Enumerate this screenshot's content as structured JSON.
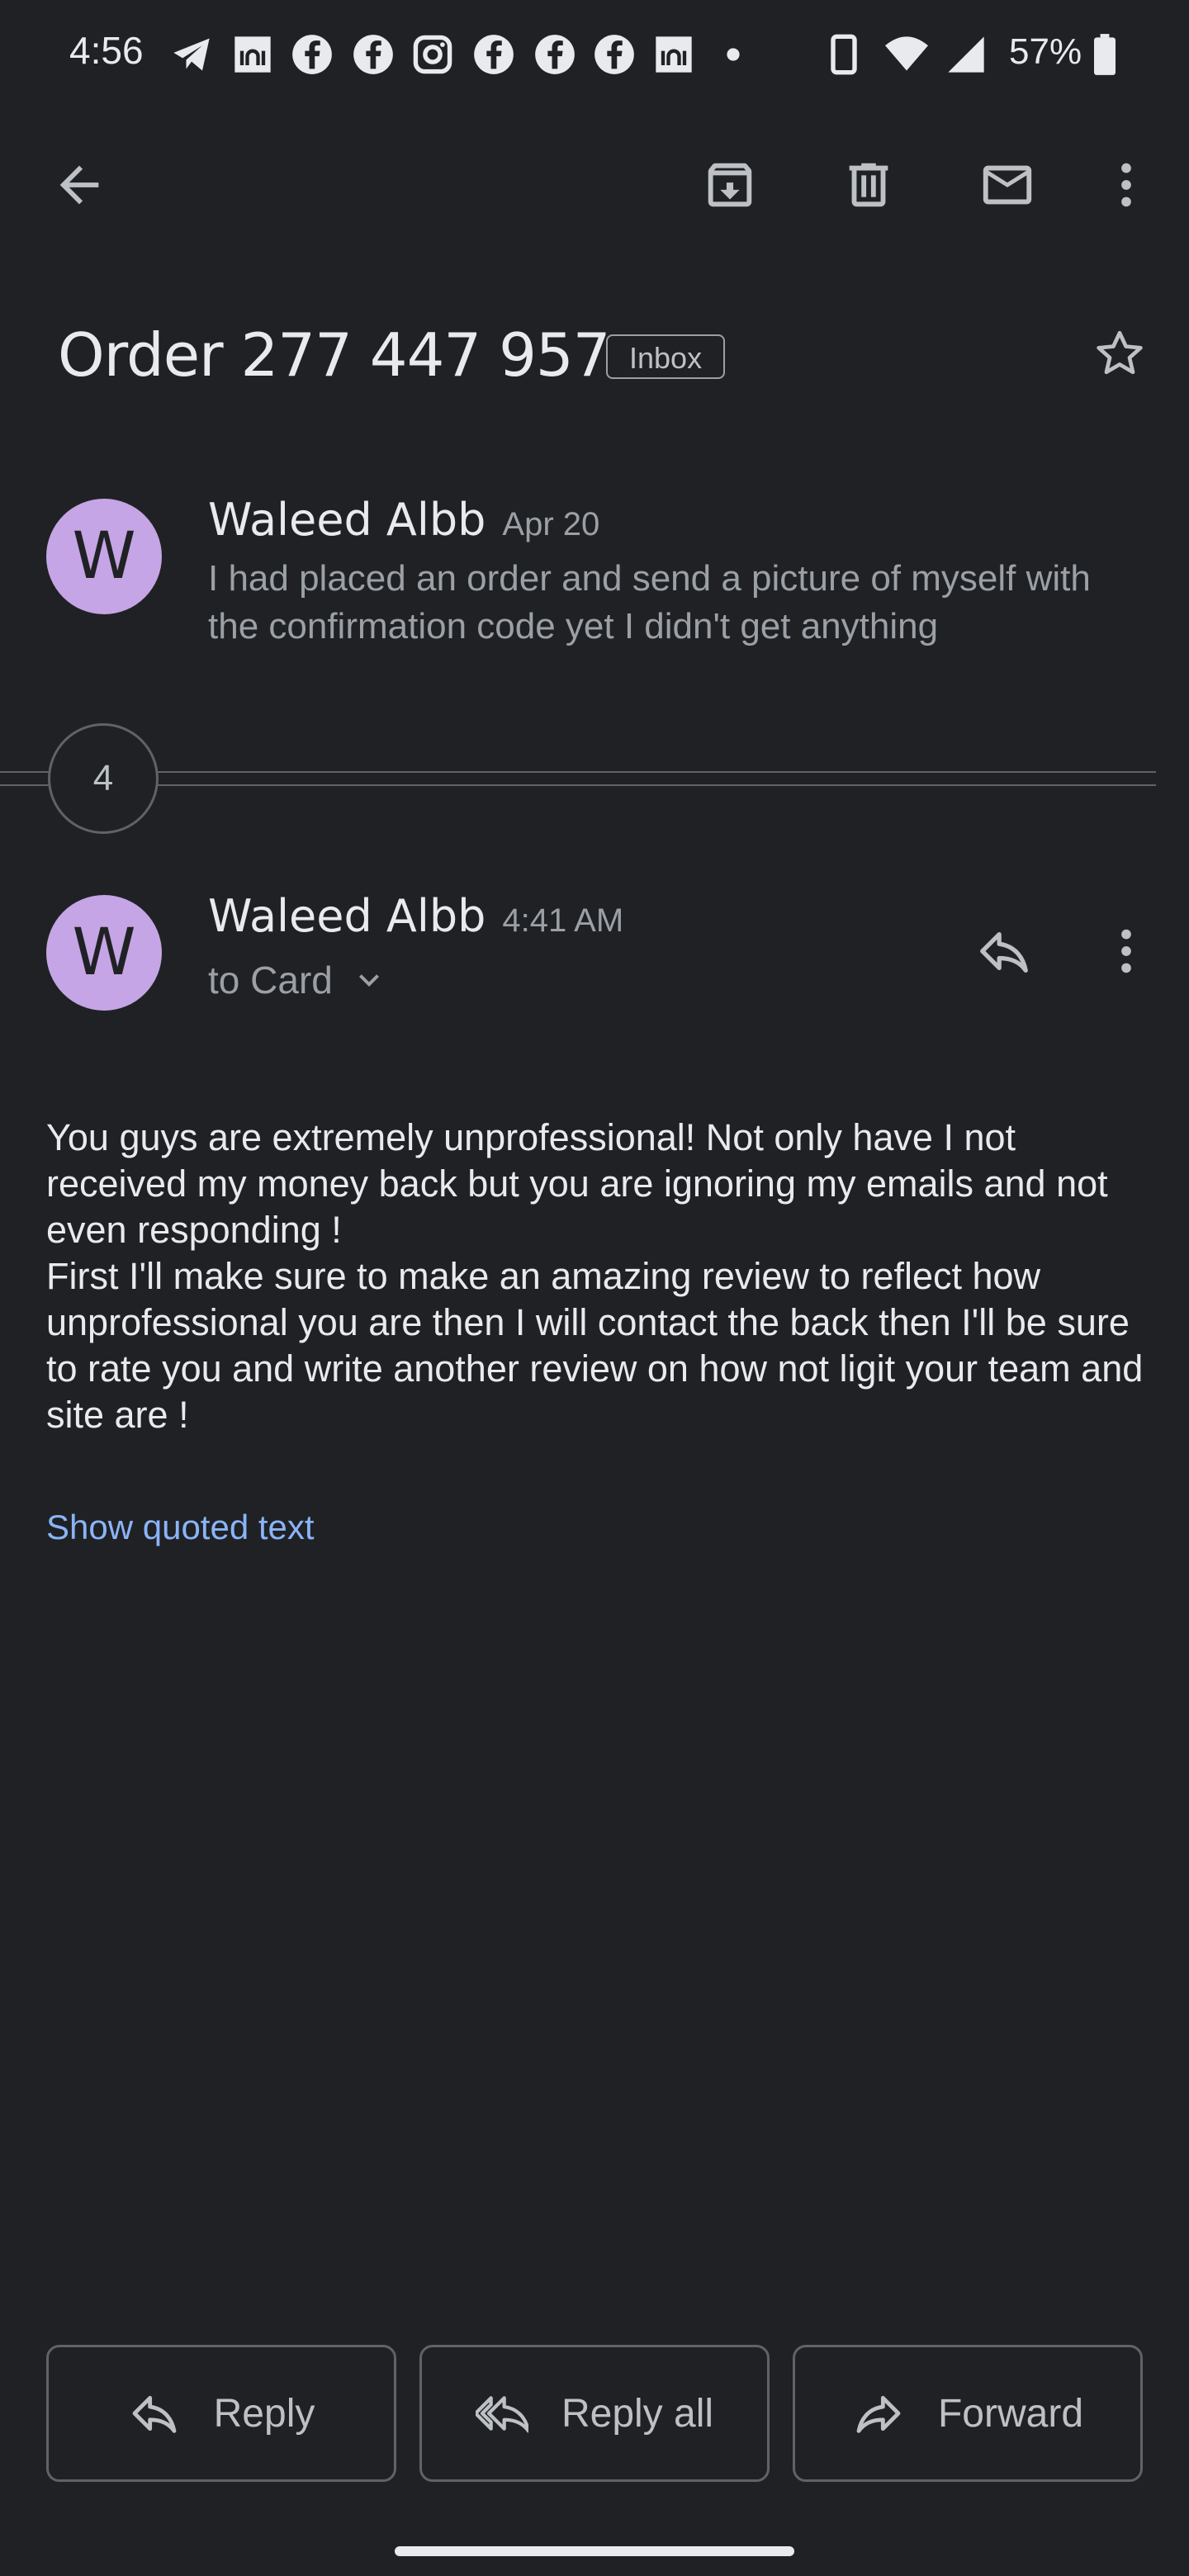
{
  "status_bar": {
    "time": "4:56",
    "notification_icons": [
      "telegram-icon",
      "mosque-app-icon",
      "facebook-icon",
      "facebook-icon",
      "instagram-icon",
      "facebook-icon",
      "facebook-icon",
      "facebook-icon",
      "mosque-app-icon",
      "dot-icon"
    ],
    "battery": "57%"
  },
  "toolbar": {
    "back_icon": "arrow-left-icon",
    "archive_icon": "archive-icon",
    "delete_icon": "trash-icon",
    "unread_icon": "mail-icon",
    "more_icon": "more-vert-icon"
  },
  "thread": {
    "subject": "Order 277 447 957",
    "label": "Inbox",
    "collapsed_count": "4"
  },
  "messages": [
    {
      "avatar_letter": "W",
      "sender": "Waleed Albb",
      "date": "Apr 20",
      "snippet": "I had placed an order and send a picture of myself with the confirmation code yet I didn't get anything"
    },
    {
      "avatar_letter": "W",
      "sender": "Waleed Albb",
      "date": "4:41 AM",
      "to": "to Card",
      "body": "You guys are extremely unprofessional! Not only have I not received my money back but you are ignoring my emails and not even responding !\nFirst I'll make sure to make an amazing review to reflect how unprofessional you are then I will contact the back then I'll be sure to rate you and write another review on how not ligit your team and site are !",
      "show_quoted": "Show quoted text"
    }
  ],
  "actions": {
    "reply": "Reply",
    "reply_all": "Reply all",
    "forward": "Forward"
  },
  "colors": {
    "background": "#202124",
    "avatar": "#c5a5e5",
    "link": "#8ab4f8"
  }
}
